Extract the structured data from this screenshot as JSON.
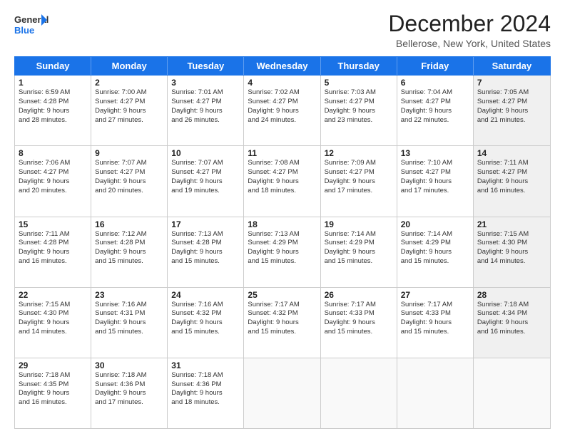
{
  "header": {
    "logo_general": "General",
    "logo_blue": "Blue",
    "month_title": "December 2024",
    "location": "Bellerose, New York, United States"
  },
  "days_of_week": [
    "Sunday",
    "Monday",
    "Tuesday",
    "Wednesday",
    "Thursday",
    "Friday",
    "Saturday"
  ],
  "weeks": [
    [
      {
        "day": "1",
        "lines": [
          "Sunrise: 6:59 AM",
          "Sunset: 4:28 PM",
          "Daylight: 9 hours",
          "and 28 minutes."
        ],
        "shaded": false
      },
      {
        "day": "2",
        "lines": [
          "Sunrise: 7:00 AM",
          "Sunset: 4:27 PM",
          "Daylight: 9 hours",
          "and 27 minutes."
        ],
        "shaded": false
      },
      {
        "day": "3",
        "lines": [
          "Sunrise: 7:01 AM",
          "Sunset: 4:27 PM",
          "Daylight: 9 hours",
          "and 26 minutes."
        ],
        "shaded": false
      },
      {
        "day": "4",
        "lines": [
          "Sunrise: 7:02 AM",
          "Sunset: 4:27 PM",
          "Daylight: 9 hours",
          "and 24 minutes."
        ],
        "shaded": false
      },
      {
        "day": "5",
        "lines": [
          "Sunrise: 7:03 AM",
          "Sunset: 4:27 PM",
          "Daylight: 9 hours",
          "and 23 minutes."
        ],
        "shaded": false
      },
      {
        "day": "6",
        "lines": [
          "Sunrise: 7:04 AM",
          "Sunset: 4:27 PM",
          "Daylight: 9 hours",
          "and 22 minutes."
        ],
        "shaded": false
      },
      {
        "day": "7",
        "lines": [
          "Sunrise: 7:05 AM",
          "Sunset: 4:27 PM",
          "Daylight: 9 hours",
          "and 21 minutes."
        ],
        "shaded": true
      }
    ],
    [
      {
        "day": "8",
        "lines": [
          "Sunrise: 7:06 AM",
          "Sunset: 4:27 PM",
          "Daylight: 9 hours",
          "and 20 minutes."
        ],
        "shaded": false
      },
      {
        "day": "9",
        "lines": [
          "Sunrise: 7:07 AM",
          "Sunset: 4:27 PM",
          "Daylight: 9 hours",
          "and 20 minutes."
        ],
        "shaded": false
      },
      {
        "day": "10",
        "lines": [
          "Sunrise: 7:07 AM",
          "Sunset: 4:27 PM",
          "Daylight: 9 hours",
          "and 19 minutes."
        ],
        "shaded": false
      },
      {
        "day": "11",
        "lines": [
          "Sunrise: 7:08 AM",
          "Sunset: 4:27 PM",
          "Daylight: 9 hours",
          "and 18 minutes."
        ],
        "shaded": false
      },
      {
        "day": "12",
        "lines": [
          "Sunrise: 7:09 AM",
          "Sunset: 4:27 PM",
          "Daylight: 9 hours",
          "and 17 minutes."
        ],
        "shaded": false
      },
      {
        "day": "13",
        "lines": [
          "Sunrise: 7:10 AM",
          "Sunset: 4:27 PM",
          "Daylight: 9 hours",
          "and 17 minutes."
        ],
        "shaded": false
      },
      {
        "day": "14",
        "lines": [
          "Sunrise: 7:11 AM",
          "Sunset: 4:27 PM",
          "Daylight: 9 hours",
          "and 16 minutes."
        ],
        "shaded": true
      }
    ],
    [
      {
        "day": "15",
        "lines": [
          "Sunrise: 7:11 AM",
          "Sunset: 4:28 PM",
          "Daylight: 9 hours",
          "and 16 minutes."
        ],
        "shaded": false
      },
      {
        "day": "16",
        "lines": [
          "Sunrise: 7:12 AM",
          "Sunset: 4:28 PM",
          "Daylight: 9 hours",
          "and 15 minutes."
        ],
        "shaded": false
      },
      {
        "day": "17",
        "lines": [
          "Sunrise: 7:13 AM",
          "Sunset: 4:28 PM",
          "Daylight: 9 hours",
          "and 15 minutes."
        ],
        "shaded": false
      },
      {
        "day": "18",
        "lines": [
          "Sunrise: 7:13 AM",
          "Sunset: 4:29 PM",
          "Daylight: 9 hours",
          "and 15 minutes."
        ],
        "shaded": false
      },
      {
        "day": "19",
        "lines": [
          "Sunrise: 7:14 AM",
          "Sunset: 4:29 PM",
          "Daylight: 9 hours",
          "and 15 minutes."
        ],
        "shaded": false
      },
      {
        "day": "20",
        "lines": [
          "Sunrise: 7:14 AM",
          "Sunset: 4:29 PM",
          "Daylight: 9 hours",
          "and 15 minutes."
        ],
        "shaded": false
      },
      {
        "day": "21",
        "lines": [
          "Sunrise: 7:15 AM",
          "Sunset: 4:30 PM",
          "Daylight: 9 hours",
          "and 14 minutes."
        ],
        "shaded": true
      }
    ],
    [
      {
        "day": "22",
        "lines": [
          "Sunrise: 7:15 AM",
          "Sunset: 4:30 PM",
          "Daylight: 9 hours",
          "and 14 minutes."
        ],
        "shaded": false
      },
      {
        "day": "23",
        "lines": [
          "Sunrise: 7:16 AM",
          "Sunset: 4:31 PM",
          "Daylight: 9 hours",
          "and 15 minutes."
        ],
        "shaded": false
      },
      {
        "day": "24",
        "lines": [
          "Sunrise: 7:16 AM",
          "Sunset: 4:32 PM",
          "Daylight: 9 hours",
          "and 15 minutes."
        ],
        "shaded": false
      },
      {
        "day": "25",
        "lines": [
          "Sunrise: 7:17 AM",
          "Sunset: 4:32 PM",
          "Daylight: 9 hours",
          "and 15 minutes."
        ],
        "shaded": false
      },
      {
        "day": "26",
        "lines": [
          "Sunrise: 7:17 AM",
          "Sunset: 4:33 PM",
          "Daylight: 9 hours",
          "and 15 minutes."
        ],
        "shaded": false
      },
      {
        "day": "27",
        "lines": [
          "Sunrise: 7:17 AM",
          "Sunset: 4:33 PM",
          "Daylight: 9 hours",
          "and 15 minutes."
        ],
        "shaded": false
      },
      {
        "day": "28",
        "lines": [
          "Sunrise: 7:18 AM",
          "Sunset: 4:34 PM",
          "Daylight: 9 hours",
          "and 16 minutes."
        ],
        "shaded": true
      }
    ],
    [
      {
        "day": "29",
        "lines": [
          "Sunrise: 7:18 AM",
          "Sunset: 4:35 PM",
          "Daylight: 9 hours",
          "and 16 minutes."
        ],
        "shaded": false
      },
      {
        "day": "30",
        "lines": [
          "Sunrise: 7:18 AM",
          "Sunset: 4:36 PM",
          "Daylight: 9 hours",
          "and 17 minutes."
        ],
        "shaded": false
      },
      {
        "day": "31",
        "lines": [
          "Sunrise: 7:18 AM",
          "Sunset: 4:36 PM",
          "Daylight: 9 hours",
          "and 18 minutes."
        ],
        "shaded": false
      },
      {
        "day": "",
        "lines": [],
        "shaded": true,
        "empty": true
      },
      {
        "day": "",
        "lines": [],
        "shaded": true,
        "empty": true
      },
      {
        "day": "",
        "lines": [],
        "shaded": true,
        "empty": true
      },
      {
        "day": "",
        "lines": [],
        "shaded": true,
        "empty": true
      }
    ]
  ]
}
